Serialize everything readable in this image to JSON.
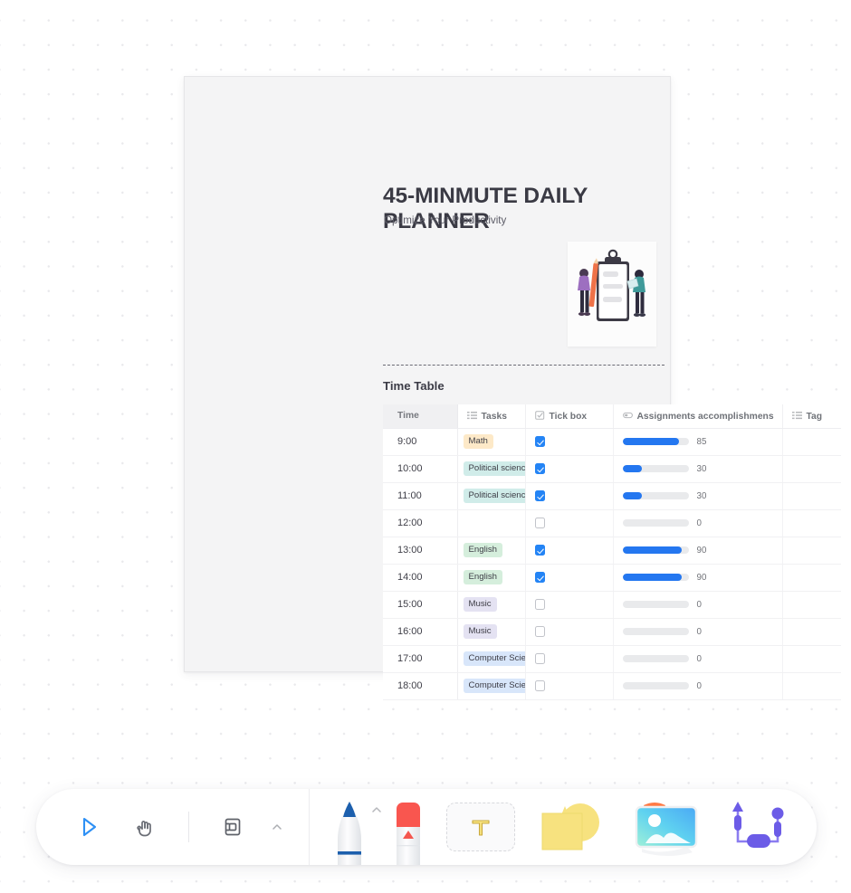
{
  "document": {
    "title": "45-MINMUTE DAILY PLANNER",
    "subtitle": "Optimize Your Productivity",
    "illustration_name": "clipboard-people-illustration",
    "section_heading": "Time Table"
  },
  "table": {
    "columns": [
      {
        "label": "Time",
        "icon": ""
      },
      {
        "label": "Tasks",
        "icon": "list-icon"
      },
      {
        "label": "Tick box",
        "icon": "checkbox-icon"
      },
      {
        "label": "Assignments accomplishmens",
        "icon": "progress-icon"
      },
      {
        "label": "Tag",
        "icon": "list-icon"
      }
    ],
    "rows": [
      {
        "time": "9:00",
        "task": "Math",
        "chip": "chip-math",
        "checked": true,
        "progress": 85,
        "progress_label": "85",
        "tag": ""
      },
      {
        "time": "10:00",
        "task": "Political science",
        "chip": "chip-polsci",
        "checked": true,
        "progress": 30,
        "progress_label": "30",
        "tag": ""
      },
      {
        "time": "11:00",
        "task": "Political science",
        "chip": "chip-polsci",
        "checked": true,
        "progress": 30,
        "progress_label": "30",
        "tag": ""
      },
      {
        "time": "12:00",
        "task": "",
        "chip": "",
        "checked": false,
        "progress": 0,
        "progress_label": "0",
        "tag": ""
      },
      {
        "time": "13:00",
        "task": "English",
        "chip": "chip-english",
        "checked": true,
        "progress": 90,
        "progress_label": "90",
        "tag": ""
      },
      {
        "time": "14:00",
        "task": "English",
        "chip": "chip-english",
        "checked": true,
        "progress": 90,
        "progress_label": "90",
        "tag": ""
      },
      {
        "time": "15:00",
        "task": "Music",
        "chip": "chip-music",
        "checked": false,
        "progress": 0,
        "progress_label": "0",
        "tag": ""
      },
      {
        "time": "16:00",
        "task": "Music",
        "chip": "chip-music",
        "checked": false,
        "progress": 0,
        "progress_label": "0",
        "tag": ""
      },
      {
        "time": "17:00",
        "task": "Computer Science",
        "chip": "chip-cs",
        "checked": false,
        "progress": 0,
        "progress_label": "0",
        "tag": ""
      },
      {
        "time": "18:00",
        "task": "Computer Science",
        "chip": "chip-cs",
        "checked": false,
        "progress": 0,
        "progress_label": "0",
        "tag": ""
      }
    ]
  },
  "toolbar": {
    "tools": [
      {
        "name": "select-cursor-tool",
        "label": "Select"
      },
      {
        "name": "hand-pan-tool",
        "label": "Hand"
      },
      {
        "name": "frame-note-tool",
        "label": "Note"
      },
      {
        "name": "pen-tool",
        "label": "Pen"
      },
      {
        "name": "eraser-tool",
        "label": "Eraser"
      },
      {
        "name": "text-tool",
        "label": "Text"
      },
      {
        "name": "sticky-shapes-tool",
        "label": "Shapes"
      },
      {
        "name": "image-tool",
        "label": "Image"
      },
      {
        "name": "connector-tool",
        "label": "Connector"
      }
    ]
  },
  "colors": {
    "accent_blue": "#2477f0",
    "select_blue": "#2e90f5",
    "pen_blue": "#1c5fad",
    "eraser_red": "#f9564f",
    "sticky_yellow": "#f7e27f",
    "connector_purple": "#6c5ce7",
    "card_bg": "#f4f4f5"
  }
}
